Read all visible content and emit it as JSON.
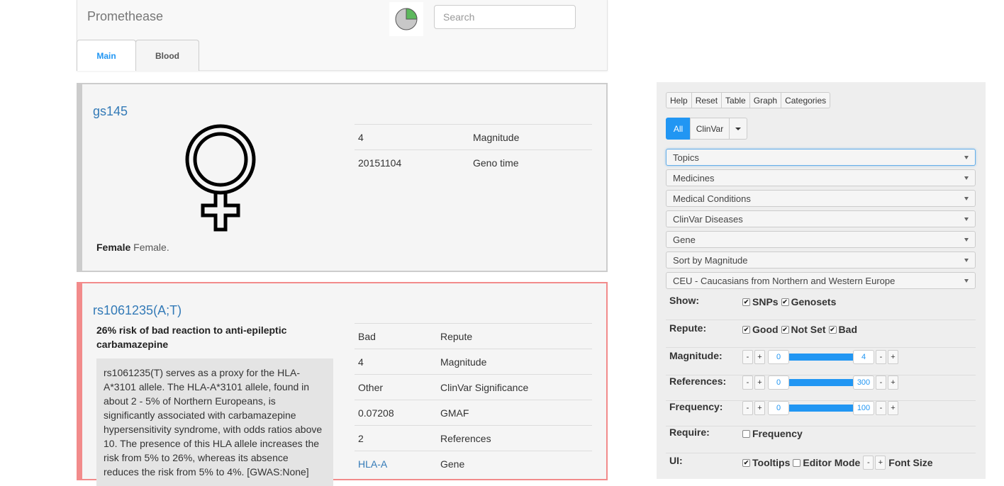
{
  "header": {
    "brand": "Promethease",
    "search_placeholder": "Search",
    "tabs": [
      {
        "label": "Main",
        "active": true
      },
      {
        "label": "Blood",
        "active": false
      }
    ]
  },
  "cards": [
    {
      "title": "gs145",
      "icon": "venus-icon",
      "summary_bold": "Female",
      "summary_text": " Female.",
      "props": [
        {
          "value": "4",
          "key": "Magnitude"
        },
        {
          "value": "20151104",
          "key": "Geno time"
        }
      ]
    },
    {
      "title": "rs1061235(A;T)",
      "accent": "#f28b8b",
      "headline": "26% risk of bad reaction to anti-epileptic carbamazepine",
      "description": "rs1061235(T) serves as a proxy for the HLA-A*3101 allele. The HLA-A*3101 allele, found in about 2 - 5% of Northern Europeans, is significantly associated with carbamazepine hypersensitivity syndrome, with odds ratios above 10. The presence of this HLA allele increases the risk from 5% to 26%, whereas its absence reduces the risk from 5% to 4%. [GWAS:None]",
      "props": [
        {
          "value": "Bad",
          "key": "Repute"
        },
        {
          "value": "4",
          "key": "Magnitude"
        },
        {
          "value": "Other",
          "key": "ClinVar Significance"
        },
        {
          "value": "0.07208",
          "key": "GMAF"
        },
        {
          "value": "2",
          "key": "References"
        },
        {
          "value": "HLA-A",
          "key": "Gene",
          "link": true
        }
      ]
    }
  ],
  "panel": {
    "buttons": [
      "Help",
      "Reset",
      "Table",
      "Graph",
      "Categories"
    ],
    "filters": {
      "all": "All",
      "clinvar": "ClinVar"
    },
    "selects": [
      "Topics",
      "Medicines",
      "Medical Conditions",
      "ClinVar Diseases",
      "Gene",
      "Sort by Magnitude",
      "CEU - Caucasians from Northern and Western Europe"
    ],
    "show": {
      "label": "Show:",
      "options": [
        {
          "label": "SNPs",
          "checked": true
        },
        {
          "label": "Genosets",
          "checked": true
        }
      ]
    },
    "repute": {
      "label": "Repute:",
      "options": [
        {
          "label": "Good",
          "checked": true
        },
        {
          "label": "Not Set",
          "checked": true
        },
        {
          "label": "Bad",
          "checked": true
        }
      ]
    },
    "magnitude": {
      "label": "Magnitude:",
      "min": "0",
      "max": "4"
    },
    "references": {
      "label": "References:",
      "min": "0",
      "max": "300"
    },
    "frequency": {
      "label": "Frequency:",
      "min": "0",
      "max": "100"
    },
    "require": {
      "label": "Require:",
      "option": {
        "label": "Frequency",
        "checked": false
      }
    },
    "ui": {
      "label": "UI:",
      "tooltips": {
        "label": "Tooltips",
        "checked": true
      },
      "editor": {
        "label": "Editor Mode",
        "checked": false
      },
      "font_size": "Font Size"
    },
    "check_glyph": "✔",
    "minus": "-",
    "plus": "+"
  },
  "colors": {
    "accent": "#2196f3",
    "bad": "#f28b8b",
    "pie_green": "#5cb85c"
  }
}
